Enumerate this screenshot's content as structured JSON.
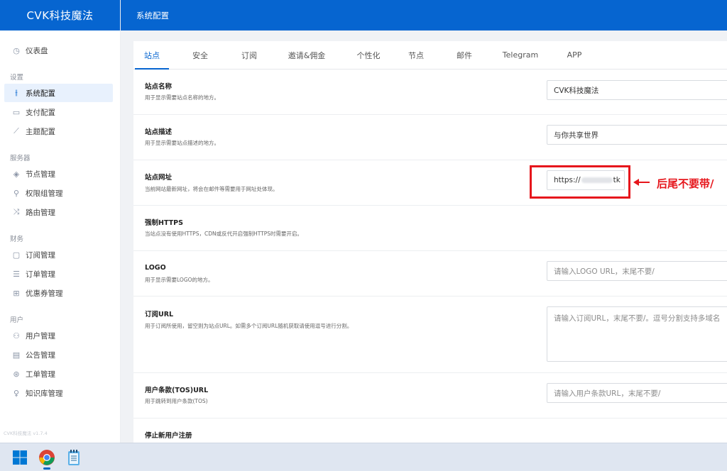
{
  "app": {
    "brand": "CVK科技魔法",
    "version": "CVK科技魔法 v1.7.4"
  },
  "header": {
    "title": "系统配置"
  },
  "sidebar": {
    "dashboard": {
      "label": "仪表盘",
      "icon": "dashboard-icon"
    },
    "groups": [
      {
        "title": "设置",
        "items": [
          {
            "label": "系统配置",
            "icon": "sliders-icon",
            "active": true
          },
          {
            "label": "支付配置",
            "icon": "card-icon"
          },
          {
            "label": "主题配置",
            "icon": "brush-icon"
          }
        ]
      },
      {
        "title": "服务器",
        "items": [
          {
            "label": "节点管理",
            "icon": "layers-icon"
          },
          {
            "label": "权限组管理",
            "icon": "wrench-icon"
          },
          {
            "label": "路由管理",
            "icon": "shuffle-icon"
          }
        ]
      },
      {
        "title": "财务",
        "items": [
          {
            "label": "订阅管理",
            "icon": "clipboard-icon"
          },
          {
            "label": "订单管理",
            "icon": "list-icon"
          },
          {
            "label": "优惠券管理",
            "icon": "gift-icon"
          }
        ]
      },
      {
        "title": "用户",
        "items": [
          {
            "label": "用户管理",
            "icon": "user-icon"
          },
          {
            "label": "公告管理",
            "icon": "message-icon"
          },
          {
            "label": "工单管理",
            "icon": "support-icon"
          },
          {
            "label": "知识库管理",
            "icon": "bulb-icon"
          }
        ]
      }
    ]
  },
  "tabs": [
    {
      "label": "站点",
      "active": true
    },
    {
      "label": "安全"
    },
    {
      "label": "订阅"
    },
    {
      "label": "邀请&佣金"
    },
    {
      "label": "个性化"
    },
    {
      "label": "节点"
    },
    {
      "label": "邮件"
    },
    {
      "label": "Telegram"
    },
    {
      "label": "APP"
    }
  ],
  "settings": [
    {
      "title": "站点名称",
      "desc": "用于显示需要站点名称的地方。",
      "value": "CVK科技魔法",
      "placeholder": ""
    },
    {
      "title": "站点描述",
      "desc": "用于显示需要站点描述的地方。",
      "value": "与你共享世界",
      "placeholder": ""
    },
    {
      "title": "站点网址",
      "desc": "当前网站最新网址，将会在邮件等需要用于网址处体现。",
      "value_prefix": "https://",
      "value_suffix": "tk"
    },
    {
      "title": "强制HTTPS",
      "desc": "当站点没有使用HTTPS，CDN或反代开启强制HTTPS时需要开启。"
    },
    {
      "title": "LOGO",
      "desc": "用于显示需要LOGO的地方。",
      "value": "",
      "placeholder": "请输入LOGO URL，末尾不要/"
    },
    {
      "title": "订阅URL",
      "desc": "用于订阅所使用，留空则为站点URL。如需多个订阅URL随机获取请使用逗号进行分割。",
      "value": "",
      "placeholder": "请输入订阅URL，末尾不要/。逗号分割支持多域名"
    },
    {
      "title": "用户条款(TOS)URL",
      "desc": "用于跳转到用户条款(TOS)",
      "value": "",
      "placeholder": "请输入用户条款URL，末尾不要/"
    },
    {
      "title": "停止新用户注册",
      "desc": ""
    }
  ],
  "annotation": {
    "text": "后尾不要带/",
    "color": "#e6161c"
  },
  "colors": {
    "primary": "#0665d0",
    "active_bg": "#e8f1fd",
    "annotation": "#e6161c"
  },
  "taskbar": [
    {
      "name": "windows-start-icon"
    },
    {
      "name": "chrome-icon",
      "running": true
    },
    {
      "name": "notepad-icon"
    }
  ]
}
